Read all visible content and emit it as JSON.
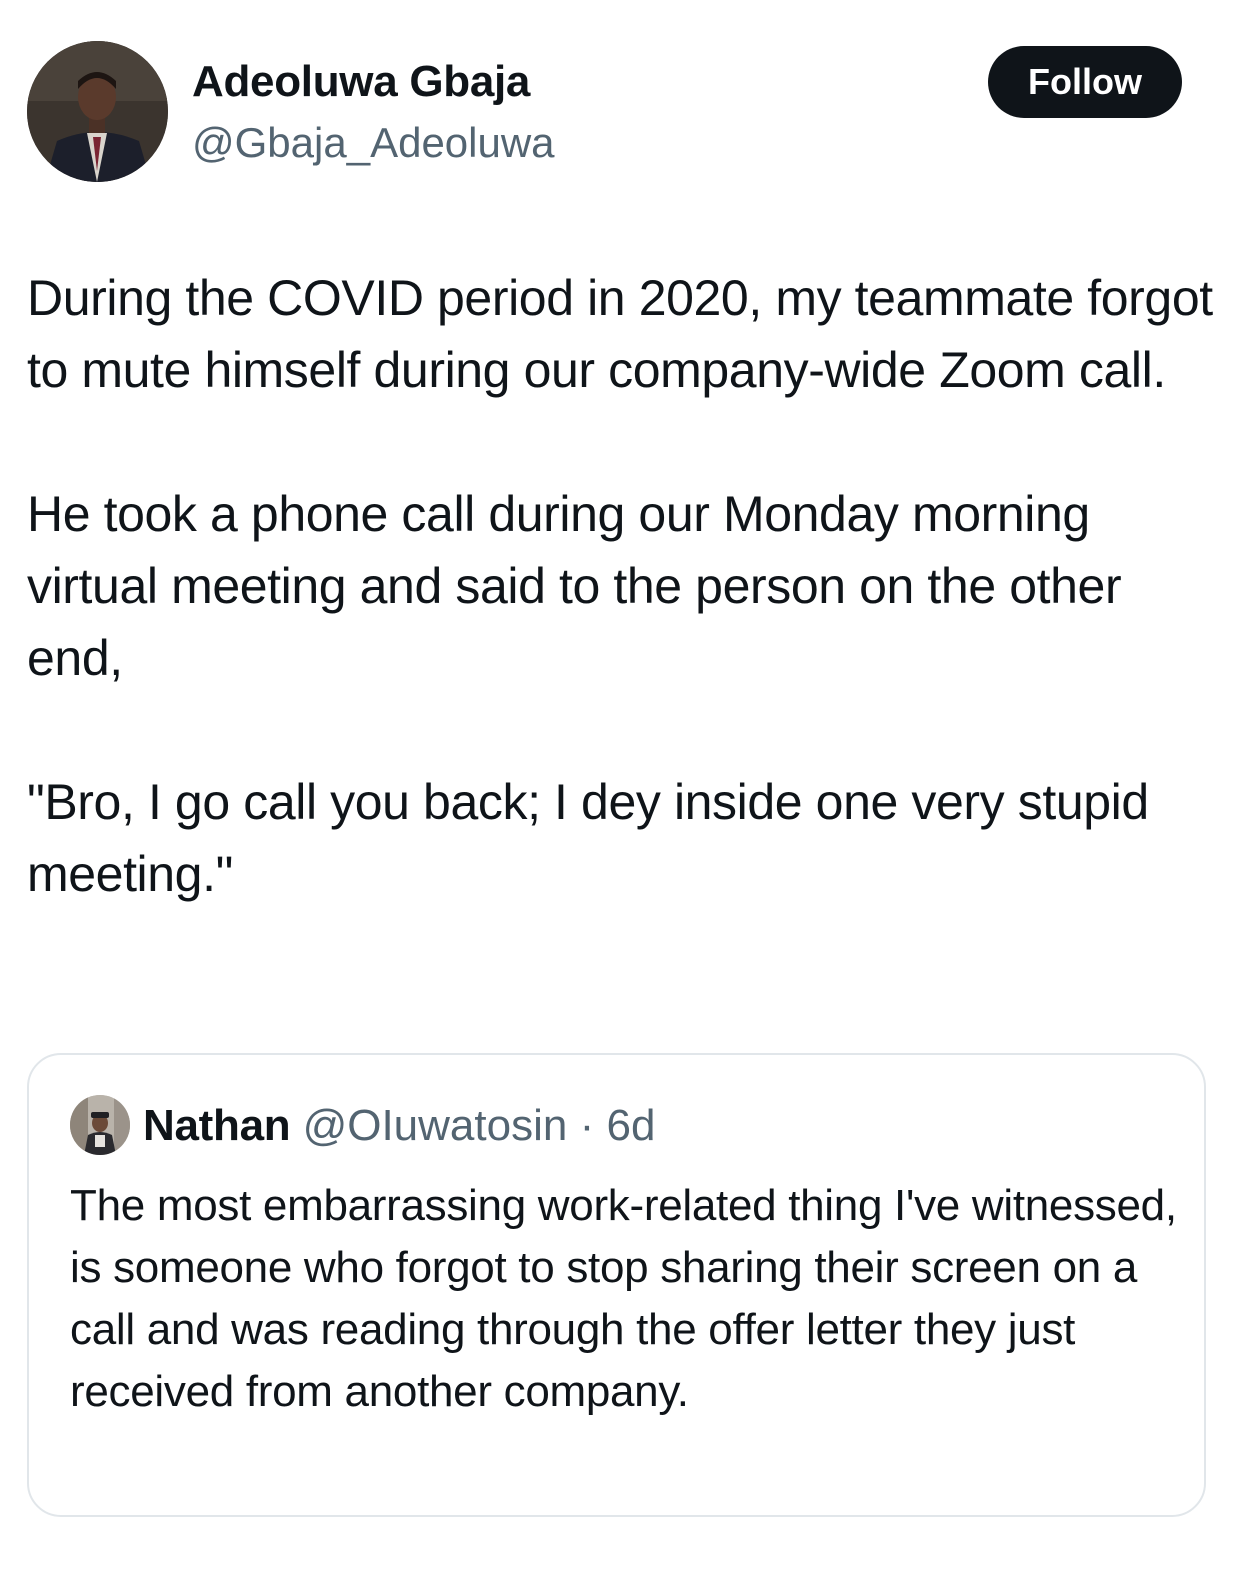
{
  "author": {
    "name": "Adeoluwa Gbaja",
    "handle": "@Gbaja_Adeoluwa",
    "avatar_icon": "profile-photo"
  },
  "follow_button": {
    "label": "Follow"
  },
  "tweet": {
    "paragraphs": [
      "During the COVID period in 2020, my teammate forgot to mute himself during our company-wide Zoom call.",
      "He took a phone call during our Monday morning virtual meeting and said to the person on the other end,",
      "\"Bro, I go call you back; I dey inside one very stupid meeting.\""
    ]
  },
  "quoted_tweet": {
    "name": "Nathan",
    "handle": "@OIuwatosin",
    "separator": "·",
    "time": "6d",
    "avatar_icon": "profile-photo",
    "text": "The most embarrassing work-related thing I've witnessed, is someone who forgot to stop sharing their screen on a call and was reading through the offer letter they just received from another company."
  },
  "colors": {
    "text_primary": "#0f1419",
    "text_secondary": "#536471",
    "follow_button_bg": "#0f1419",
    "card_border": "#e1e6ea"
  }
}
